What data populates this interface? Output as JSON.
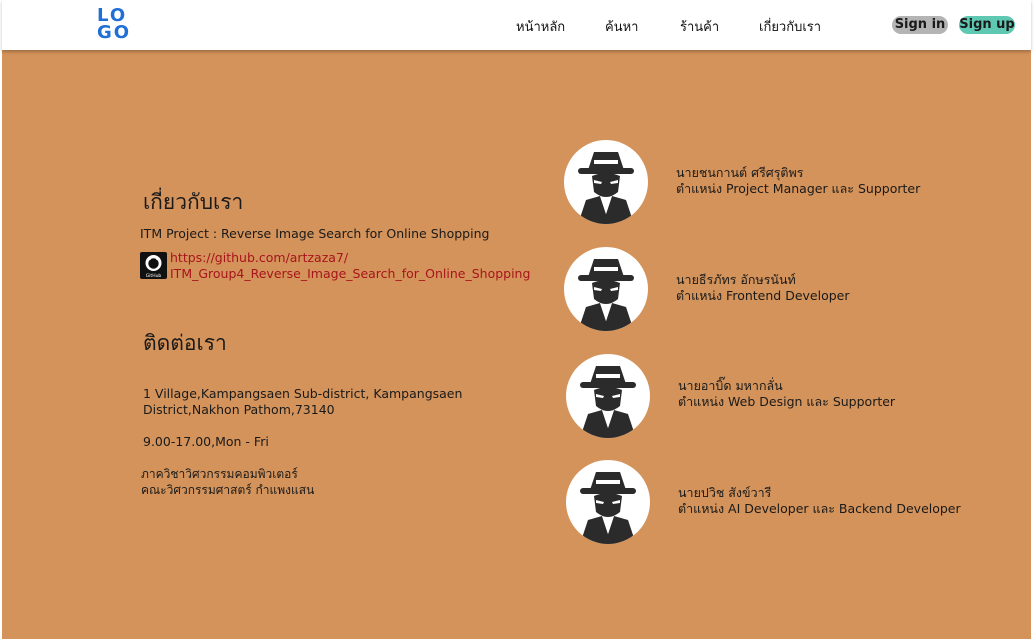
{
  "navbar": {
    "logo_line1": "LO",
    "logo_line2": "GO",
    "links": [
      "หน้าหลัก",
      "ค้นหา",
      "ร้านค้า",
      "เกี่ยวกับเรา"
    ],
    "signin_label": "Sign in",
    "signup_label": "Sign up"
  },
  "about": {
    "heading": "เกี่ยวกับเรา",
    "project": "ITM Project : Reverse Image Search for Online Shopping",
    "github_line1": "https://github.com/artzaza7/",
    "github_line2": "ITM_Group4_Reverse_Image_Search_for_Online_Shopping",
    "github_icon_text": "GitHub"
  },
  "contact": {
    "heading": "ติดต่อเรา",
    "address_line1": "1 Village,Kampangsaen Sub-district, Kampangsaen",
    "address_line2": "District,Nakhon Pathom,73140",
    "hours": "9.00-17.00,Mon - Fri",
    "dept_line1": "ภาควิชาวิศวกรรมคอมพิวเตอร์",
    "dept_line2": "คณะวิศวกรรมศาสตร์ กำแพงแสน"
  },
  "members": [
    {
      "name": "นายชนกานต์ ศรีศรุติพร",
      "role": "ตำแหน่ง Project Manager และ Supporter"
    },
    {
      "name": "นายธีรภัทร อักษรนันท์",
      "role": "ตำแหน่ง Frontend Developer"
    },
    {
      "name": "นายอาบิ๊ด มหากลั่น",
      "role": "ตำแหน่ง Web Design และ Supporter"
    },
    {
      "name": "นายปวิช สังข์วารี",
      "role": "ตำแหน่ง AI Developer และ Backend Developer"
    }
  ],
  "colors": {
    "background": "#d4935a",
    "logo": "#1f6fd6",
    "signin_bg": "#b4b4b4",
    "signup_bg": "#5ec8b3",
    "link": "#a8141c"
  },
  "icons": {
    "avatar": "spy-avatar-icon",
    "github": "github-icon"
  }
}
